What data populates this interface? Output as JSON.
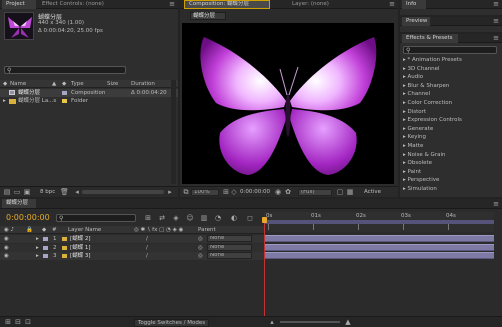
{
  "project": {
    "tab_project": "Project",
    "tab_effect_controls": "Effect Controls: (none)",
    "comp_name": "蝴蝶分层",
    "comp_size": "440 x 340 (1.00)",
    "comp_duration": "Δ 0:00:04:20, 25.00 fps",
    "search_placeholder": "",
    "columns": {
      "name": "Name",
      "type": "Type",
      "size": "Size",
      "duration": "Duration"
    },
    "items": [
      {
        "name": "蝴蝶分层",
        "type": "Composition",
        "size": "",
        "duration": "Δ 0:00:04:20",
        "color": "#a6a6c6"
      },
      {
        "name": "蝴蝶分层 La...s",
        "type": "Folder",
        "size": "",
        "duration": "",
        "color": "#e8c64c"
      }
    ],
    "bpc": "8 bpc"
  },
  "viewer": {
    "tab_composition": "Composition: 蝴蝶分层",
    "tab_layer": "Layer: (none)",
    "comp_button": "蝴蝶分层",
    "zoom": "100%",
    "timecode": "0:00:00:00",
    "resolution": "(Full)",
    "active_camera": "Active"
  },
  "info": {
    "tab": "Info"
  },
  "preview": {
    "tab": "Preview"
  },
  "effects": {
    "tab": "Effects & Presets",
    "search_placeholder": "",
    "items": [
      "* Animation Presets",
      "3D Channel",
      "Audio",
      "Blur & Sharpen",
      "Channel",
      "Color Correction",
      "Distort",
      "Expression Controls",
      "Generate",
      "Keying",
      "Matte",
      "Noise & Grain",
      "Obsolete",
      "Paint",
      "Perspective",
      "Simulation"
    ]
  },
  "timeline": {
    "tab": "蝴蝶分层",
    "timecode": "0:00:00:00",
    "columns": {
      "num": "#",
      "layer_name": "Layer Name",
      "parent": "Parent"
    },
    "ruler": [
      "0s",
      "01s",
      "02s",
      "03s",
      "04s"
    ],
    "layers": [
      {
        "num": "1",
        "name": "[蝴蝶 2]",
        "parent": "None",
        "color": "#a6a6c6"
      },
      {
        "num": "2",
        "name": "[蝴蝶 1]",
        "parent": "None",
        "color": "#a6a6c6"
      },
      {
        "num": "3",
        "name": "[蝴蝶 3]",
        "parent": "None",
        "color": "#a6a6c6"
      }
    ],
    "toggle_label": "Toggle Switches / Modes"
  }
}
